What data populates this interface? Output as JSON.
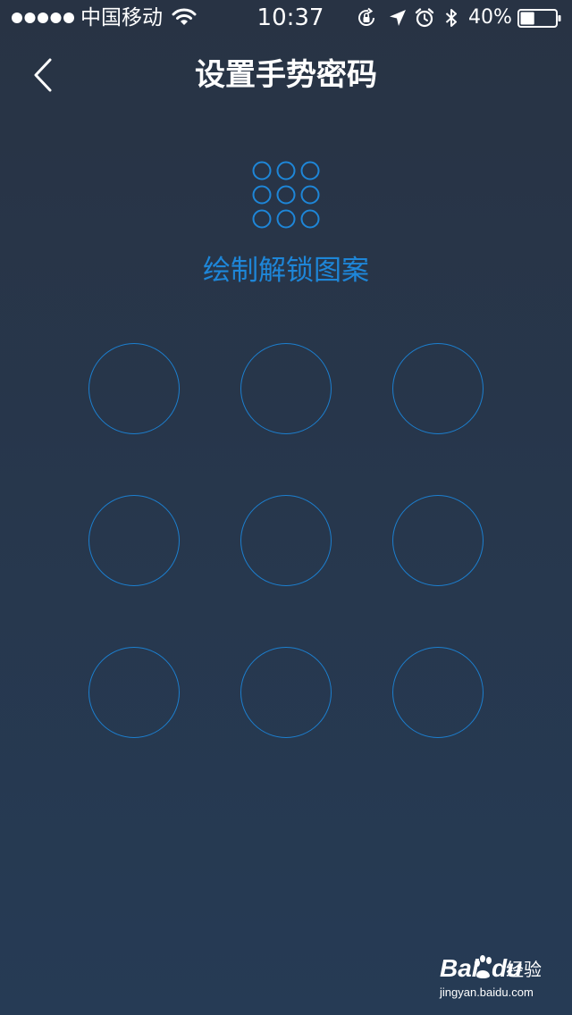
{
  "status_bar": {
    "carrier": "中国移动",
    "time": "10:37",
    "battery_percent": "40%",
    "battery_level": 0.4,
    "icons": [
      "signal-icon",
      "wifi-icon",
      "orientation-lock-icon",
      "location-arrow-icon",
      "alarm-icon",
      "bluetooth-icon",
      "battery-icon"
    ]
  },
  "nav": {
    "back_icon": "chevron-left-icon",
    "title": "设置手势密码"
  },
  "preview": {
    "icon": "pattern-preview-icon",
    "instruction": "绘制解锁图案"
  },
  "gesture_grid": {
    "rows": 3,
    "cols": 3,
    "selected": []
  },
  "colors": {
    "accent": "#1e86d8",
    "ring": "#1c7fcf",
    "background_top": "#283344",
    "background_bottom": "#263b55",
    "text": "#ffffff"
  },
  "watermark": {
    "brand_left": "Bai",
    "brand_right": "du",
    "product": "经验",
    "url": "jingyan.baidu.com"
  }
}
